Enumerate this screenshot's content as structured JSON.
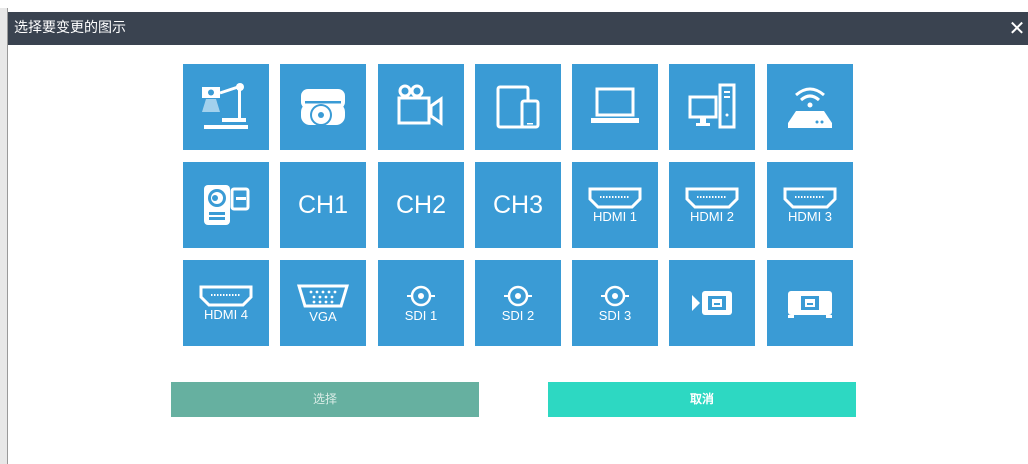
{
  "dialog": {
    "title": "选择要变更的图示",
    "close_label": "✕"
  },
  "icons": [
    {
      "name": "document-camera",
      "label": ""
    },
    {
      "name": "disc-player",
      "label": ""
    },
    {
      "name": "video-camera",
      "label": ""
    },
    {
      "name": "tablet-phone",
      "label": ""
    },
    {
      "name": "laptop",
      "label": ""
    },
    {
      "name": "desktop-pc",
      "label": ""
    },
    {
      "name": "wireless-router",
      "label": ""
    },
    {
      "name": "camcorder",
      "label": ""
    },
    {
      "name": "ch1",
      "label": "CH1"
    },
    {
      "name": "ch2",
      "label": "CH2"
    },
    {
      "name": "ch3",
      "label": "CH3"
    },
    {
      "name": "hdmi-1",
      "label": "HDMI 1"
    },
    {
      "name": "hdmi-2",
      "label": "HDMI 2"
    },
    {
      "name": "hdmi-3",
      "label": "HDMI 3"
    },
    {
      "name": "hdmi-4",
      "label": "HDMI 4"
    },
    {
      "name": "vga",
      "label": "VGA"
    },
    {
      "name": "sdi-1",
      "label": "SDI 1"
    },
    {
      "name": "sdi-2",
      "label": "SDI 2"
    },
    {
      "name": "sdi-3",
      "label": "SDI 3"
    },
    {
      "name": "network-camera",
      "label": ""
    },
    {
      "name": "network-projector",
      "label": ""
    }
  ],
  "buttons": {
    "select_label": "选择",
    "cancel_label": "取消"
  },
  "colors": {
    "titlebar": "#3a4350",
    "tile": "#3a9bd5",
    "select_button": "#66b0a0",
    "cancel_button": "#2dd8c2"
  }
}
